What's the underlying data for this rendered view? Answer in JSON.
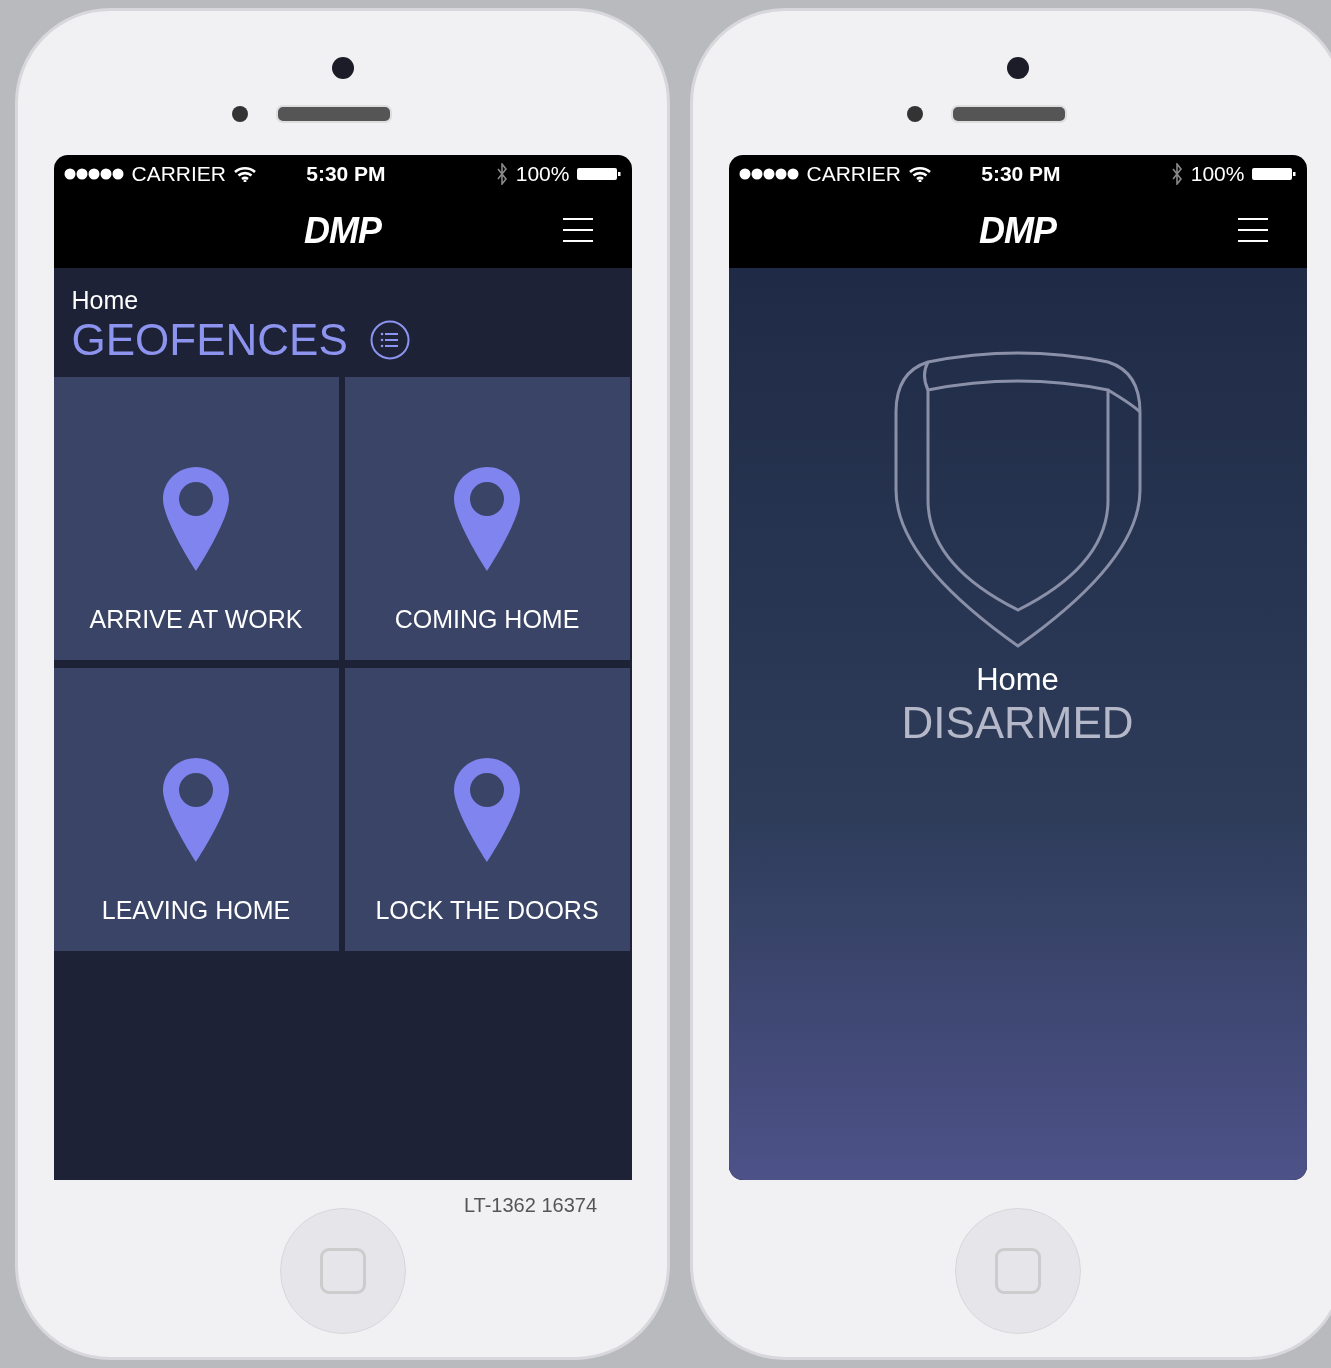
{
  "phones": [
    {
      "kind": "geofences",
      "status_bar": {
        "carrier": "CARRIER",
        "time": "5:30 PM",
        "battery": "100%"
      },
      "logo": "DMP",
      "header": {
        "subtitle": "Home",
        "title": "GEOFENCES"
      },
      "tiles": [
        {
          "label": "ARRIVE AT WORK"
        },
        {
          "label": "COMING HOME"
        },
        {
          "label": "LEAVING HOME"
        },
        {
          "label": "LOCK THE DOORS"
        }
      ],
      "caption": "LT-1362 16374"
    },
    {
      "kind": "status",
      "status_bar": {
        "carrier": "CARRIER",
        "time": "5:30 PM",
        "battery": "100%"
      },
      "logo": "DMP",
      "system": "Home",
      "state": "DISARMED"
    }
  ]
}
